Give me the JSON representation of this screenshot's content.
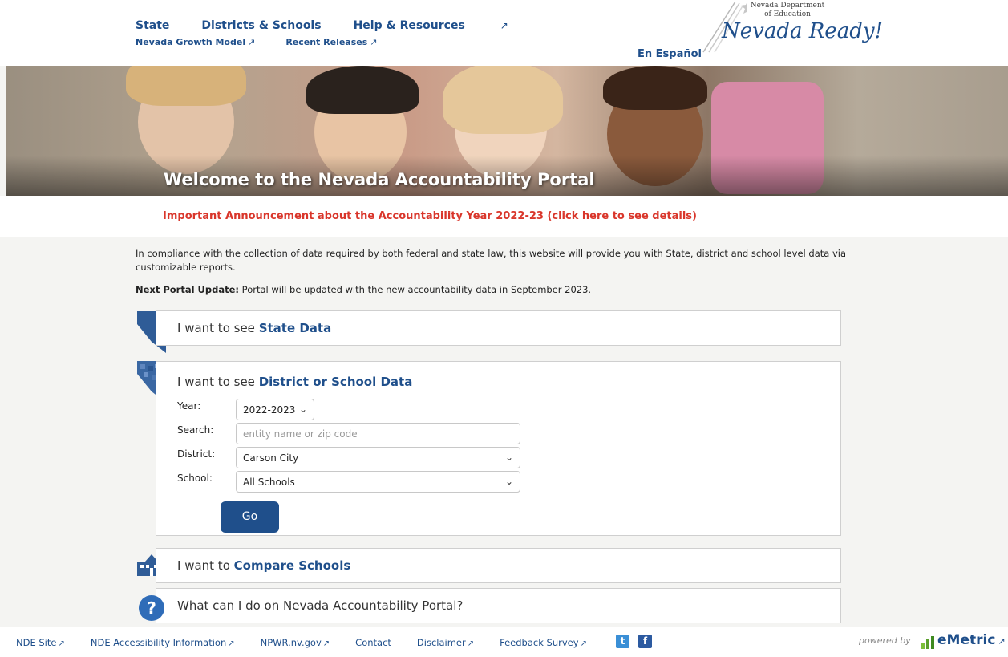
{
  "header": {
    "nav": [
      {
        "label": "State",
        "external": false
      },
      {
        "label": "Districts & Schools",
        "external": false
      },
      {
        "label": "Help & Resources",
        "external": true
      }
    ],
    "subnav": [
      {
        "label": "Nevada Growth Model",
        "external": true
      },
      {
        "label": "Recent Releases",
        "external": true
      }
    ],
    "language_link": "En Español",
    "logo": {
      "department": "Nevada Department of Education",
      "script": "Nevada Ready!"
    },
    "external_icon": "external-link-icon"
  },
  "hero": {
    "title": "Welcome to the Nevada Accountability Portal"
  },
  "announcement": "Important Announcement about the Accountability Year 2022-23 (click here to see details)",
  "intro_text": "In compliance with the collection of data required by both federal and state law, this website will provide you with State, district and school level data via customizable reports.",
  "next_update": {
    "label": "Next Portal Update:",
    "text": " Portal will be updated with the new accountability data in September 2023."
  },
  "panels": {
    "state": {
      "prefix": "I want to see ",
      "emphasis": "State Data"
    },
    "district": {
      "prefix": "I want to see ",
      "emphasis": "District or School Data",
      "year_label": "Year:",
      "year_value": "2022-2023",
      "search_label": "Search:",
      "search_placeholder": "entity name or zip code",
      "district_label": "District:",
      "district_value": "Carson City",
      "school_label": "School:",
      "school_value": "All Schools",
      "go_label": "Go"
    },
    "compare": {
      "prefix": "I want to ",
      "emphasis": "Compare Schools"
    },
    "help": {
      "text": "What can I do on Nevada Accountability Portal?"
    }
  },
  "footer": {
    "links": [
      {
        "label": "NDE Site",
        "external": true
      },
      {
        "label": "NDE Accessibility Information",
        "external": true
      },
      {
        "label": "NPWR.nv.gov",
        "external": true
      },
      {
        "label": "Contact",
        "external": false
      },
      {
        "label": "Disclaimer",
        "external": true
      },
      {
        "label": "Feedback Survey",
        "external": true
      }
    ],
    "powered_by": "powered by",
    "vendor": "eMetric"
  },
  "colors": {
    "brand_blue": "#1f4f8b",
    "announcement_red": "#d9362b",
    "twitter": "#3a8fd6",
    "facebook": "#2c5aa0"
  }
}
